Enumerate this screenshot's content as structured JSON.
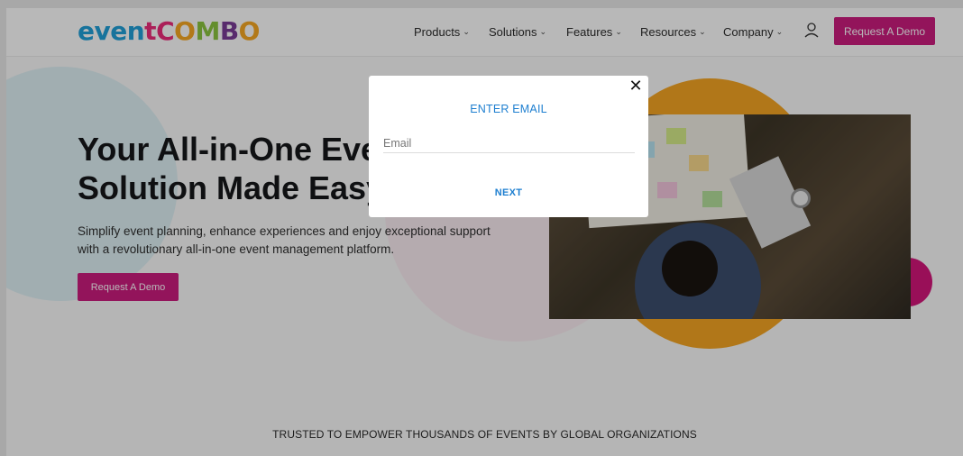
{
  "header": {
    "logo": {
      "part1": "even",
      "part2": "t",
      "part3": "COMBO"
    },
    "nav": [
      {
        "label": "Products"
      },
      {
        "label": "Solutions"
      },
      {
        "label": "Features"
      },
      {
        "label": "Resources"
      },
      {
        "label": "Company"
      }
    ],
    "demo_button": "Request A Demo"
  },
  "hero": {
    "title_line1": "Your All-in-One Eve",
    "title_line2": "Solution Made Easy",
    "subtitle": "Simplify event planning, enhance experiences and enjoy exceptional support with a revolutionary all-in-one event management platform.",
    "demo_button": "Request A Demo"
  },
  "trusted": "TRUSTED TO EMPOWER THOUSANDS OF EVENTS BY GLOBAL ORGANIZATIONS",
  "modal": {
    "title": "ENTER EMAIL",
    "email_placeholder": "Email",
    "email_value": "",
    "next_button": "NEXT",
    "close_glyph": "✕"
  },
  "colors": {
    "brand_magenta": "#cc1d7f",
    "link_blue": "#1e7fd0",
    "accent_orange": "#f5a623"
  }
}
